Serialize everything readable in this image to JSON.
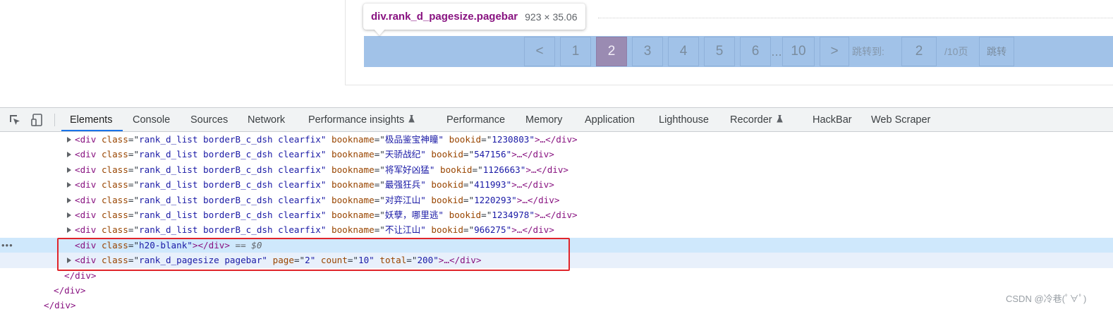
{
  "tooltip": {
    "tag": "div.rank_d_pagesize.pagebar",
    "size": "923 × 35.06"
  },
  "pagination": {
    "prev": "<",
    "pages": [
      "1",
      "2",
      "3",
      "4",
      "5",
      "6"
    ],
    "ellipsis": "...",
    "last_page": "10",
    "next": ">",
    "jump_label": "跳转到:",
    "jump_value": "2",
    "total_pages": "/10页",
    "jump_button": "跳转",
    "current_page": "2"
  },
  "devtools": {
    "tabs": [
      "Elements",
      "Console",
      "Sources",
      "Network",
      "Performance insights",
      "Performance",
      "Memory",
      "Application",
      "Lighthouse",
      "Recorder",
      "HackBar",
      "Web Scraper"
    ],
    "active_tab": "Elements",
    "lines": [
      {
        "open": "<div",
        "attrs": [
          [
            "class",
            "rank_d_list borderB_c_dsh clearfix"
          ],
          [
            "bookname",
            "极品鉴宝神瞳"
          ],
          [
            "bookid",
            "1230803"
          ]
        ],
        "close": ">…</div>"
      },
      {
        "open": "<div",
        "attrs": [
          [
            "class",
            "rank_d_list borderB_c_dsh clearfix"
          ],
          [
            "bookname",
            "天骄战纪"
          ],
          [
            "bookid",
            "547156"
          ]
        ],
        "close": ">…</div>"
      },
      {
        "open": "<div",
        "attrs": [
          [
            "class",
            "rank_d_list borderB_c_dsh clearfix"
          ],
          [
            "bookname",
            "将军好凶猛"
          ],
          [
            "bookid",
            "1126663"
          ]
        ],
        "close": ">…</div>"
      },
      {
        "open": "<div",
        "attrs": [
          [
            "class",
            "rank_d_list borderB_c_dsh clearfix"
          ],
          [
            "bookname",
            "最强狂兵"
          ],
          [
            "bookid",
            "411993"
          ]
        ],
        "close": ">…</div>"
      },
      {
        "open": "<div",
        "attrs": [
          [
            "class",
            "rank_d_list borderB_c_dsh clearfix"
          ],
          [
            "bookname",
            "对弈江山"
          ],
          [
            "bookid",
            "1220293"
          ]
        ],
        "close": ">…</div>"
      },
      {
        "open": "<div",
        "attrs": [
          [
            "class",
            "rank_d_list borderB_c_dsh clearfix"
          ],
          [
            "bookname",
            "妖孽，哪里逃"
          ],
          [
            "bookid",
            "1234978"
          ]
        ],
        "close": ">…</div>"
      },
      {
        "open": "<div",
        "attrs": [
          [
            "class",
            "rank_d_list borderB_c_dsh clearfix"
          ],
          [
            "bookname",
            "不让江山"
          ],
          [
            "bookid",
            "966275"
          ]
        ],
        "close": ">…</div>"
      },
      {
        "open": "<div",
        "attrs": [
          [
            "class",
            "h20-blank"
          ]
        ],
        "close": "></div>",
        "suffix": " == $0"
      },
      {
        "open": "<div",
        "attrs": [
          [
            "class",
            "rank_d_pagesize pagebar"
          ],
          [
            "page",
            "2"
          ],
          [
            "count",
            "10"
          ],
          [
            "total",
            "200"
          ]
        ],
        "close": ">…</div>"
      },
      {
        "text": "</div>"
      },
      {
        "text": "</div>"
      },
      {
        "text": "</div>"
      }
    ],
    "selected_dots": "•••"
  },
  "watermark": "CSDN @冷巷(ﾟ∀ﾟ)"
}
